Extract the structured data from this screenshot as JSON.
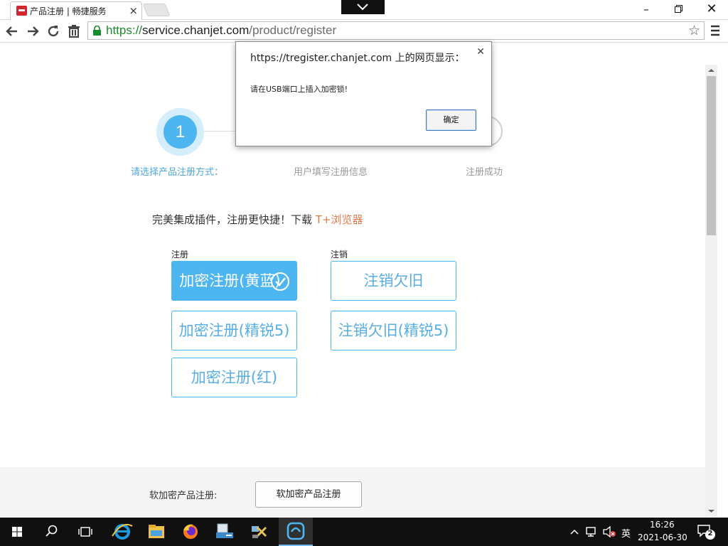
{
  "browser": {
    "tab_title": "产品注册 | 畅捷服务",
    "url_scheme": "https://",
    "url_host": "service.chanjet.com",
    "url_path": "/product/register"
  },
  "stepper": {
    "active_number": "1",
    "steps": [
      "请选择产品注册方式：",
      "用户填写注册信息",
      "注册成功"
    ]
  },
  "promo": {
    "text": "完美集成插件，注册更快捷！下载",
    "link": "T+浏览器"
  },
  "register_group": {
    "label": "注册",
    "buttons": [
      "加密注册(黄蓝)",
      "加密注册(精锐5)",
      "加密注册(红)"
    ],
    "selected_index": 0
  },
  "cancel_group": {
    "label": "注销",
    "buttons": [
      "注销欠旧",
      "注销欠旧(精锐5)"
    ]
  },
  "soft": {
    "label": "软加密产品注册:",
    "button": "软加密产品注册"
  },
  "dialog": {
    "title": "https://tregister.chanjet.com 上的网页显示：",
    "message": "请在USB端口上插入加密锁!",
    "ok": "确定"
  },
  "taskbar": {
    "ime": "英",
    "time": "16:26",
    "date": "2021-06-30",
    "notifications": "2"
  },
  "colors": {
    "accent": "#4db5f0",
    "link_orange": "#e07a4c",
    "url_green": "#1c8a2e"
  }
}
